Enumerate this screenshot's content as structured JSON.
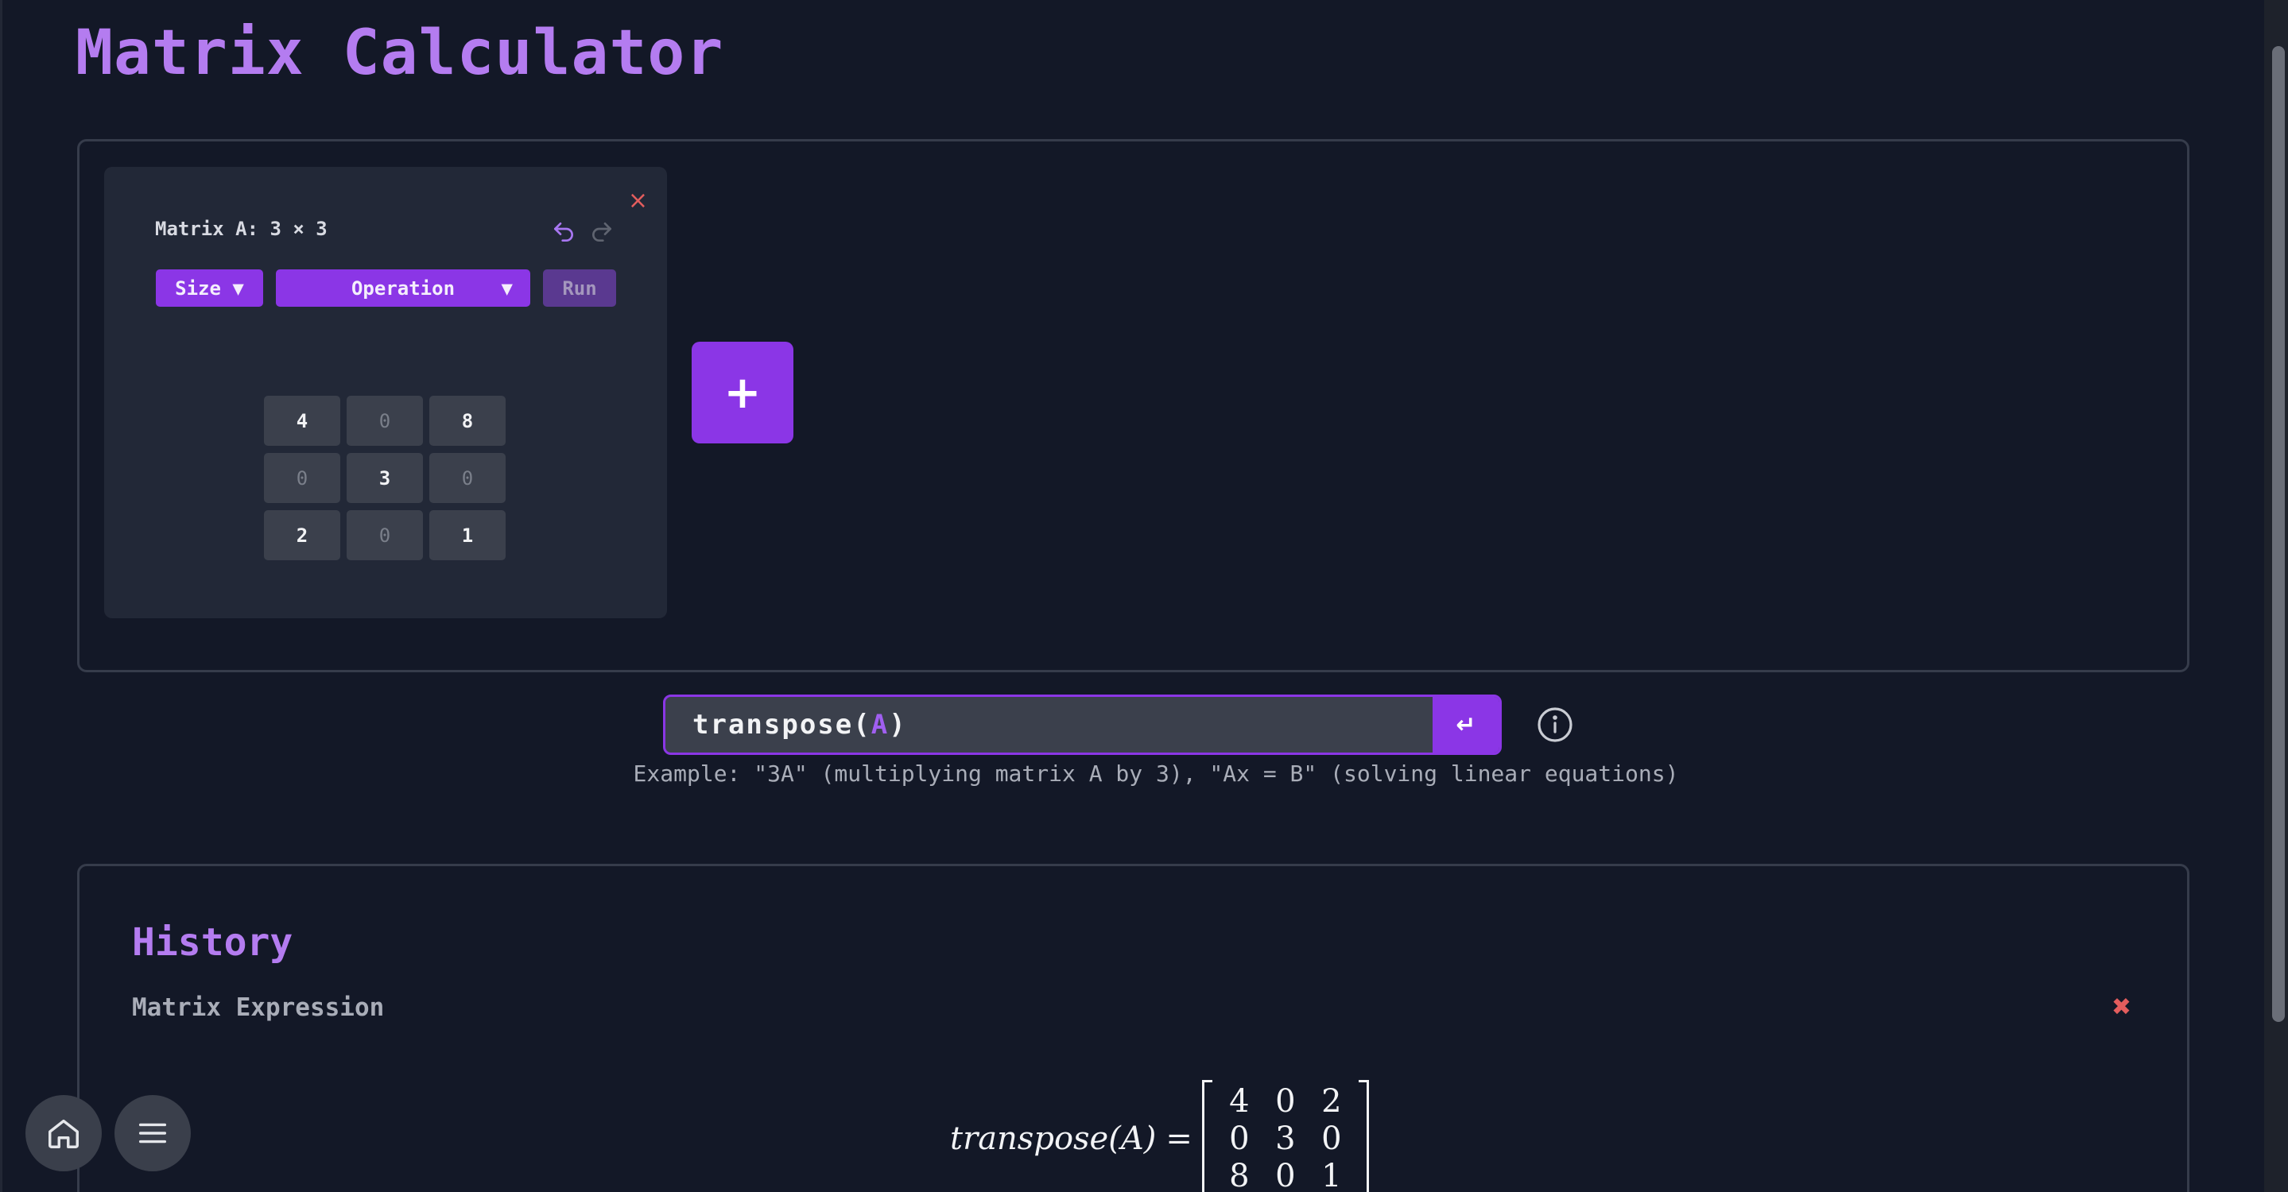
{
  "page": {
    "title": "Matrix Calculator"
  },
  "matrix_card": {
    "title": "Matrix A: 3 × 3",
    "close_label": "×",
    "size_label": "Size ▼",
    "operation_label": "Operation",
    "operation_caret": "▼",
    "run_label": "Run",
    "cells": [
      [
        "4",
        "0",
        "8"
      ],
      [
        "0",
        "3",
        "0"
      ],
      [
        "2",
        "0",
        "1"
      ]
    ]
  },
  "add_matrix": {
    "label": "+"
  },
  "expression": {
    "prefix": "transpose(",
    "variable": "A",
    "suffix": ")",
    "enter_label": "↵"
  },
  "hint": "Example: \"3A\" (multiplying matrix A by 3), \"Ax = B\" (solving linear equations)",
  "history": {
    "title": "History",
    "subtitle": "Matrix Expression",
    "clear_label": "✖",
    "formula": {
      "lhs": "transpose(A)",
      "eq": "=",
      "result": [
        [
          "4",
          "0",
          "2"
        ],
        [
          "0",
          "3",
          "0"
        ],
        [
          "8",
          "0",
          "1"
        ]
      ]
    }
  },
  "colors": {
    "accent": "#8b36e6",
    "title": "#b47cf0",
    "background": "#131827",
    "danger": "#e35d5d"
  },
  "icons": [
    "undo-icon",
    "redo-icon",
    "info-icon",
    "home-icon",
    "menu-icon"
  ]
}
